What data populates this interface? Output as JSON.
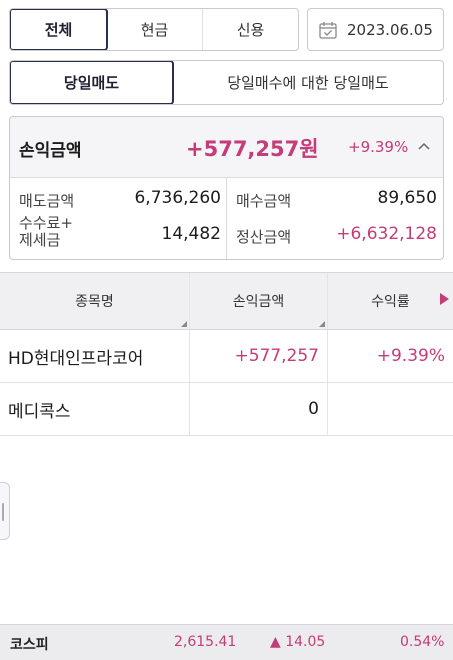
{
  "tabs": {
    "items": [
      "전체",
      "현금",
      "신용"
    ],
    "active": 0
  },
  "date": {
    "value": "2023.06.05",
    "icon": "calendar-icon"
  },
  "subtabs": {
    "items": [
      "당일매도",
      "당일매수에 대한 당일매도"
    ],
    "active": 0
  },
  "summary": {
    "label": "손익금액",
    "amount": "+577,257원",
    "rate": "+9.39%",
    "toggle_icon": "chevron-up-icon",
    "sell_label": "매도금액",
    "sell_value": "6,736,260",
    "buy_label": "매수금액",
    "buy_value": "89,650",
    "fee_label_line1": "수수료+",
    "fee_label_line2": "제세금",
    "fee_value": "14,482",
    "settle_label": "정산금액",
    "settle_value": "+6,632,128"
  },
  "table": {
    "headers": [
      "종목명",
      "손익금액",
      "수익률"
    ],
    "rows": [
      {
        "name": "HD현대인프라코어",
        "pnl": "+577,257",
        "rate": "+9.39%"
      },
      {
        "name": "메디콕스",
        "pnl": "0",
        "rate": ""
      }
    ]
  },
  "ticker": {
    "name": "코스피",
    "index": "2,615.41",
    "change": "▲ 14.05",
    "rate": "0.54%"
  },
  "colors": {
    "accent_pink": "#c43c78",
    "active_border": "#2c2f4a"
  }
}
